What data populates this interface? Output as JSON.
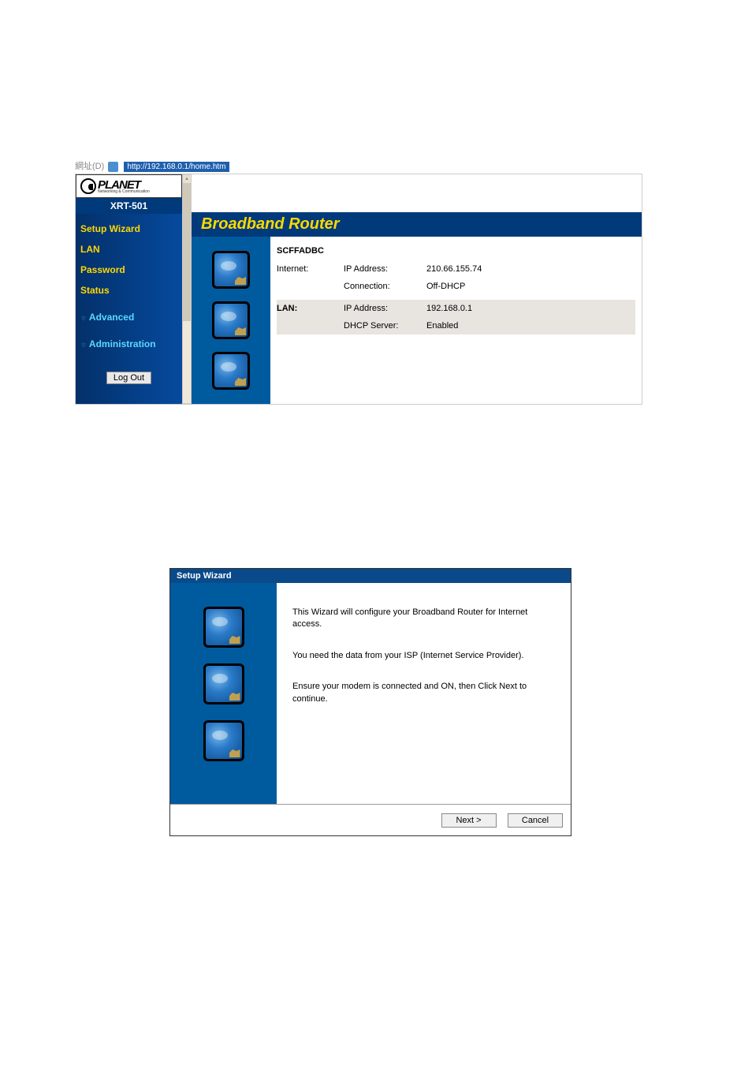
{
  "addressBar": {
    "label": "網址(D)",
    "url": "http://192.168.0.1/home.htm"
  },
  "logo": {
    "brand": "PLANET",
    "tagline": "Networking & Communication",
    "model": "XRT-501"
  },
  "nav": {
    "setupWizard": "Setup Wizard",
    "lan": "LAN",
    "password": "Password",
    "status": "Status",
    "advanced": "Advanced",
    "administration": "Administration",
    "logout": "Log Out"
  },
  "main": {
    "heading": "Broadband Router",
    "hostname": "SCFFADBC",
    "internet": {
      "label": "Internet:",
      "ipLabel": "IP Address:",
      "ipValue": "210.66.155.74",
      "connLabel": "Connection:",
      "connValue": "Off-DHCP"
    },
    "lan": {
      "label": "LAN:",
      "ipLabel": "IP Address:",
      "ipValue": "192.168.0.1",
      "dhcpLabel": "DHCP Server:",
      "dhcpValue": "Enabled"
    }
  },
  "wizard": {
    "title": "Setup Wizard",
    "p1": "This Wizard will configure your Broadband Router for Internet access.",
    "p2": "You need the data from your ISP (Internet Service Provider).",
    "p3": "Ensure your modem is connected and ON, then Click Next to continue.",
    "next": "Next >",
    "cancel": "Cancel"
  }
}
